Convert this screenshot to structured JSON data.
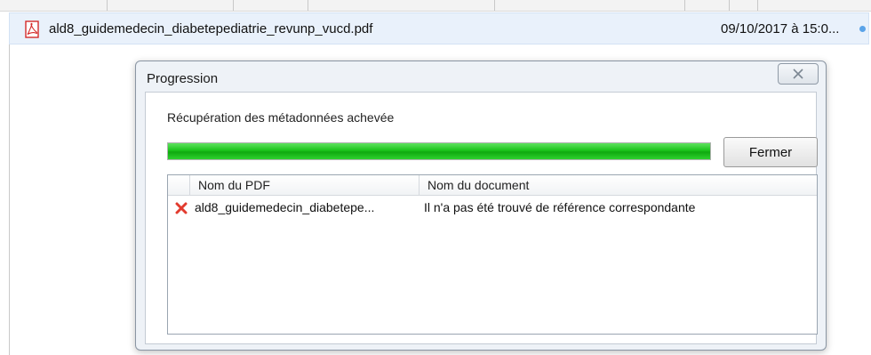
{
  "file_list": {
    "row": {
      "icon": "pdf-file-icon",
      "name": "ald8_guidemedecin_diabetepediatrie_revunp_vucd.pdf",
      "date": "09/10/2017 à 15:0..."
    }
  },
  "dialog": {
    "title": "Progression",
    "close_icon": "close-x-icon",
    "status_text": "Récupération des métadonnées achevée",
    "progress": {
      "fraction": 1.0,
      "color": "#1bc41b"
    },
    "close_button_label": "Fermer",
    "table": {
      "columns": [
        "Nom du PDF",
        "Nom du document"
      ],
      "rows": [
        {
          "status_icon": "error-x-icon",
          "pdf_name": "ald8_guidemedecin_diabetepe...",
          "document_name": "Il n'a pas été trouvé de référence correspondante"
        }
      ]
    }
  },
  "colors": {
    "error_red": "#e23b2e",
    "pdf_red": "#d42a2a",
    "selection_blue": "#e9f1fb"
  }
}
